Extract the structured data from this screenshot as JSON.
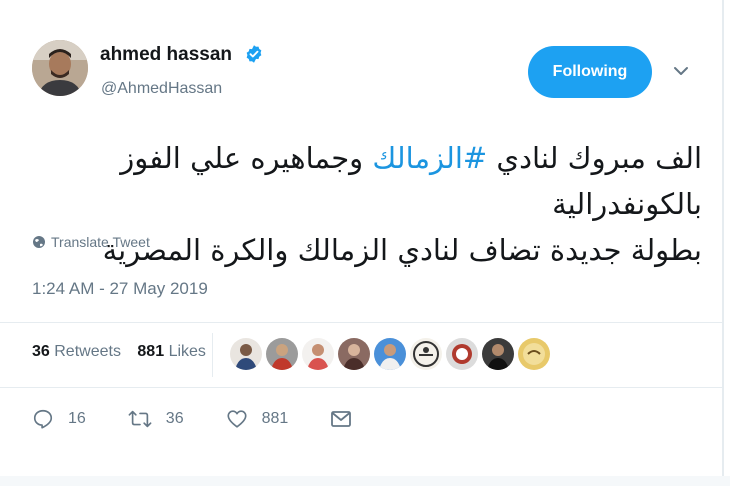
{
  "author": {
    "name": "ahmed hassan",
    "handle": "@AhmedHassan"
  },
  "follow_button": {
    "label": "Following"
  },
  "tweet": {
    "line1_before": "الف مبروك لنادي",
    "hashtag": "#الزمالك",
    "line1_after": "وجماهيره علي الفوز بالكونفدرالية",
    "line2": "بطولة جديدة تضاف لنادي الزمالك والكرة المصرية"
  },
  "translate_label": "Translate Tweet",
  "timestamp": "1:24 AM - 27 May 2019",
  "stats": {
    "retweets_count": "36",
    "retweets_label": "Retweets",
    "likes_count": "881",
    "likes_label": "Likes"
  },
  "actions": {
    "replies": "16",
    "retweets": "36",
    "likes": "881"
  },
  "colors": {
    "accent": "#1da1f2",
    "hashtag": "#1b95e0",
    "muted": "#657786"
  },
  "icons": [
    "verified-badge-icon",
    "chevron-down-icon",
    "globe-icon",
    "reply-icon",
    "retweet-icon",
    "heart-icon",
    "message-icon"
  ]
}
